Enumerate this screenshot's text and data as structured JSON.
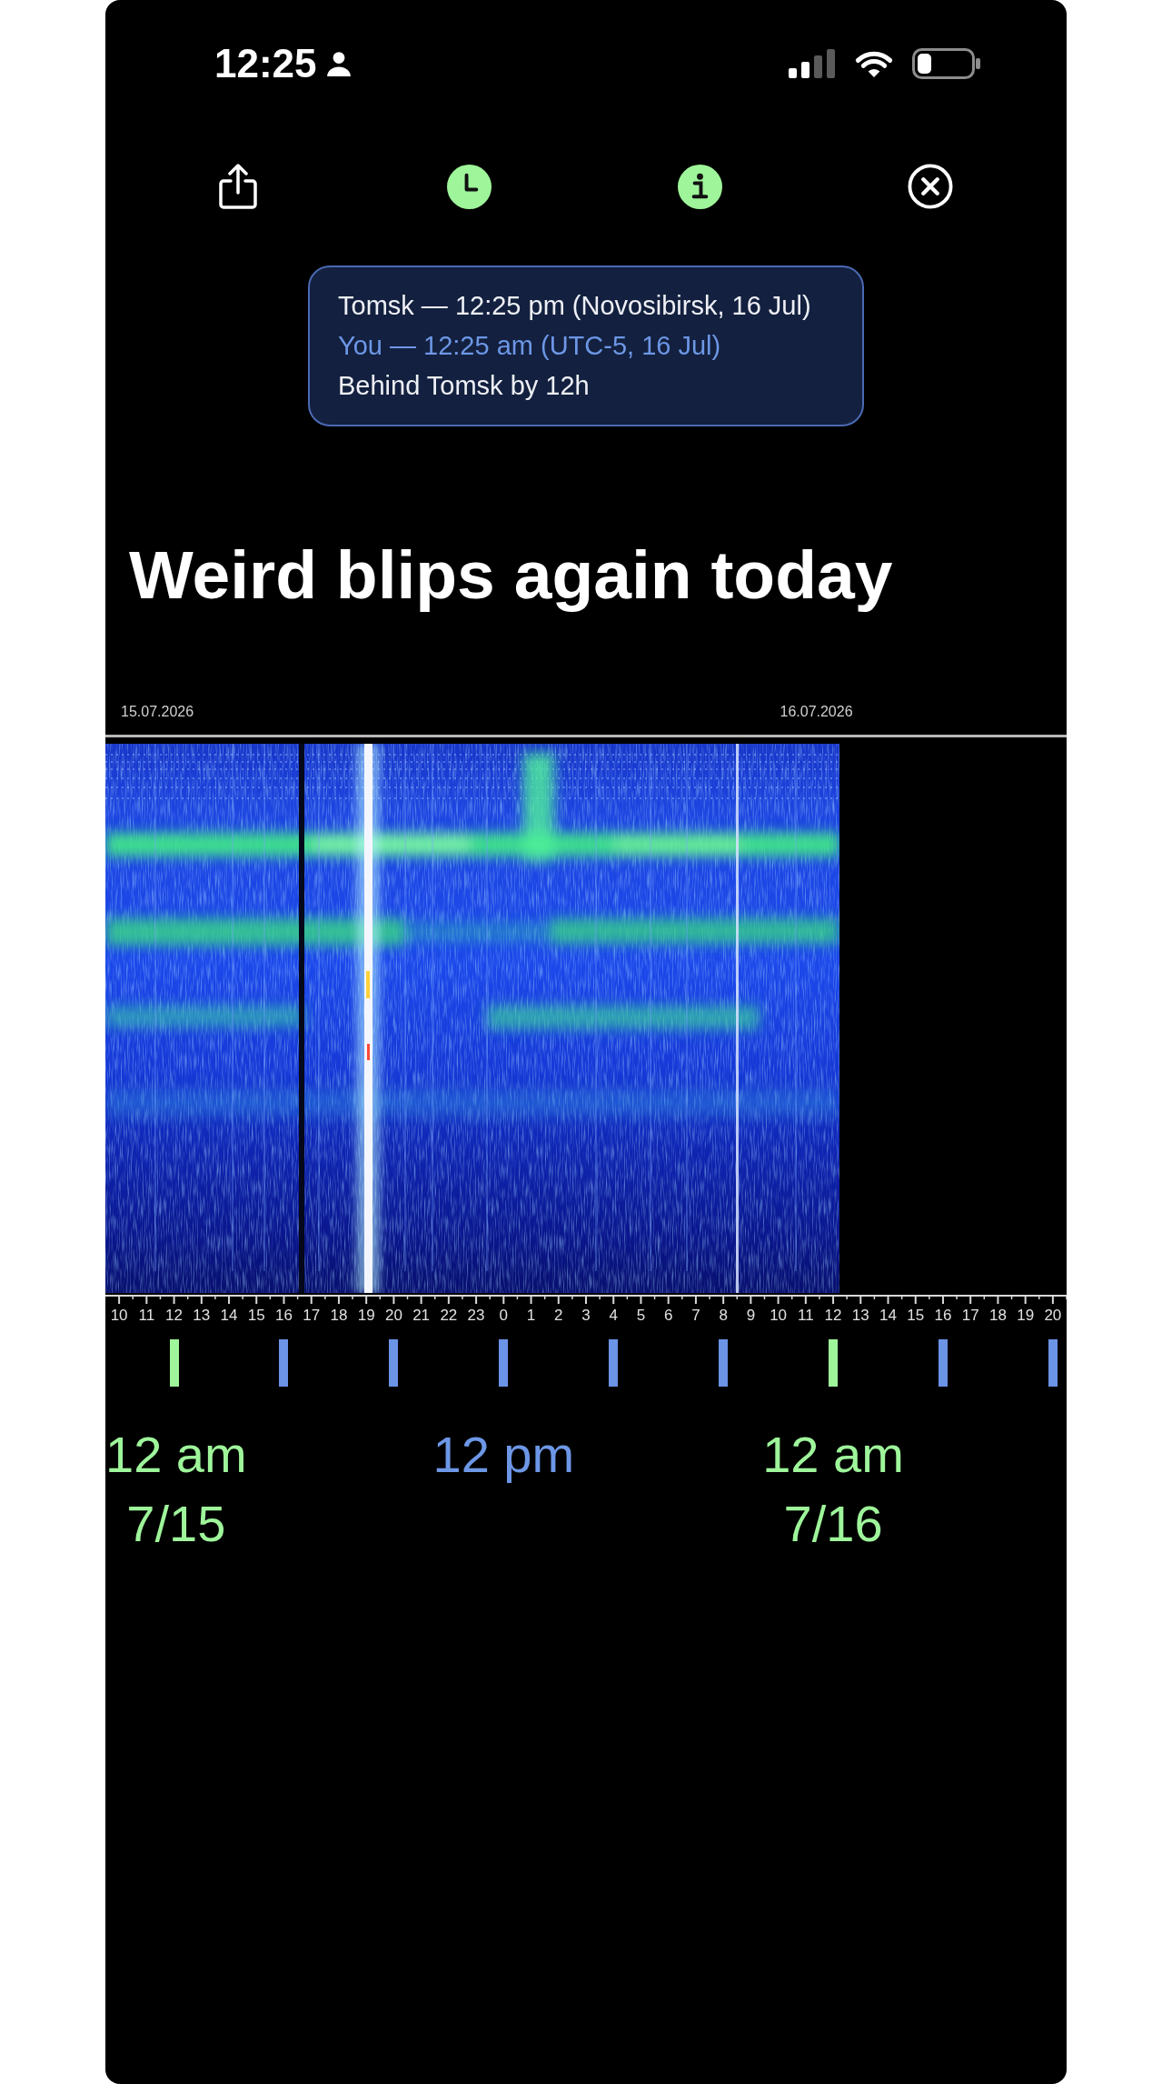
{
  "status_bar": {
    "time": "12:25"
  },
  "time_popover": {
    "lines": [
      {
        "text": "Tomsk — 12:25 pm (Novosibirsk, 16 Jul)",
        "color": "#eef0f6"
      },
      {
        "text": "You — 12:25 am (UTC-5, 16 Jul)",
        "color": "#6d97e6"
      },
      {
        "text": "Behind Tomsk by 12h",
        "color": "#eef0f6"
      }
    ]
  },
  "post": {
    "title": "Weird blips again today"
  },
  "spectrogram": {
    "dates": [
      "15.07.2026",
      "16.07.2026"
    ],
    "hours": [
      "10",
      "11",
      "12",
      "13",
      "14",
      "15",
      "16",
      "17",
      "18",
      "19",
      "20",
      "21",
      "22",
      "23",
      "0",
      "1",
      "2",
      "3",
      "4",
      "5",
      "6",
      "7",
      "8",
      "9",
      "10",
      "11",
      "12",
      "13",
      "14",
      "15",
      "16",
      "17",
      "18",
      "19",
      "20"
    ]
  },
  "timeline": {
    "markers": [
      {
        "color": "#9ef59a"
      },
      {
        "color": "#6b93e6"
      },
      {
        "color": "#6b93e6"
      },
      {
        "color": "#6b93e6"
      },
      {
        "color": "#6b93e6"
      },
      {
        "color": "#6b93e6"
      },
      {
        "color": "#9ef59a"
      },
      {
        "color": "#6b93e6"
      },
      {
        "color": "#6b93e6"
      }
    ],
    "labels": [
      {
        "time": "12 am",
        "date": "7/15",
        "color": "#9ef59a"
      },
      {
        "time": "12 pm",
        "color": "#6d97e6"
      },
      {
        "time": "12 am",
        "date": "7/16",
        "color": "#9ef59a"
      }
    ]
  }
}
